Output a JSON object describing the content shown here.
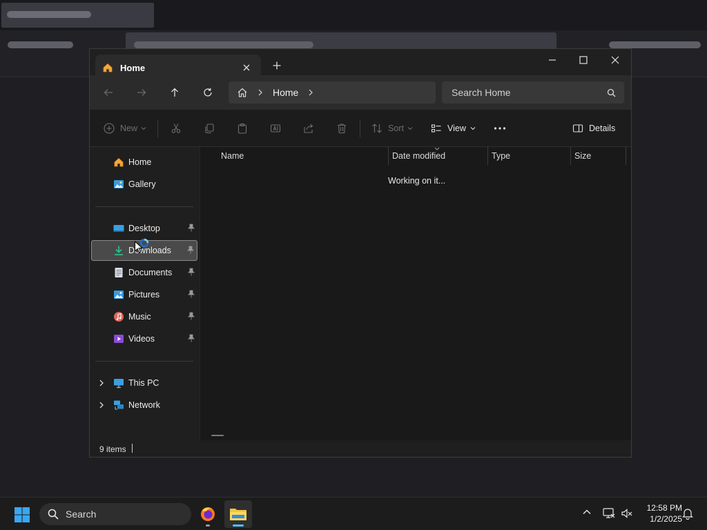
{
  "window": {
    "tab_title": "Home",
    "address": {
      "current": "Home"
    },
    "search": {
      "placeholder": "Search Home"
    }
  },
  "toolbar": {
    "new_label": "New",
    "sort_label": "Sort",
    "view_label": "View",
    "details_label": "Details"
  },
  "sidebar": {
    "quick": [
      {
        "label": "Home",
        "icon": "home-icon"
      },
      {
        "label": "Gallery",
        "icon": "gallery-icon"
      }
    ],
    "pinned": [
      {
        "label": "Desktop",
        "icon": "desktop-folder-icon",
        "pinned": true
      },
      {
        "label": "Downloads",
        "icon": "downloads-folder-icon",
        "pinned": true,
        "selected": true
      },
      {
        "label": "Documents",
        "icon": "documents-folder-icon",
        "pinned": true
      },
      {
        "label": "Pictures",
        "icon": "pictures-folder-icon",
        "pinned": true
      },
      {
        "label": "Music",
        "icon": "music-folder-icon",
        "pinned": true
      },
      {
        "label": "Videos",
        "icon": "videos-folder-icon",
        "pinned": true
      }
    ],
    "locations": [
      {
        "label": "This PC",
        "icon": "this-pc-icon"
      },
      {
        "label": "Network",
        "icon": "network-icon"
      }
    ]
  },
  "content": {
    "columns": [
      "Name",
      "Date modified",
      "Type",
      "Size"
    ],
    "loading_text": "Working on it..."
  },
  "status": {
    "item_count": "9 items"
  },
  "taskbar": {
    "search_label": "Search",
    "time": "12:58 PM",
    "date": "1/2/2025"
  },
  "colors": {
    "accent": "#4cc2ff",
    "folder_yellow": "#f4c542",
    "selection": "#4a4a4a"
  }
}
